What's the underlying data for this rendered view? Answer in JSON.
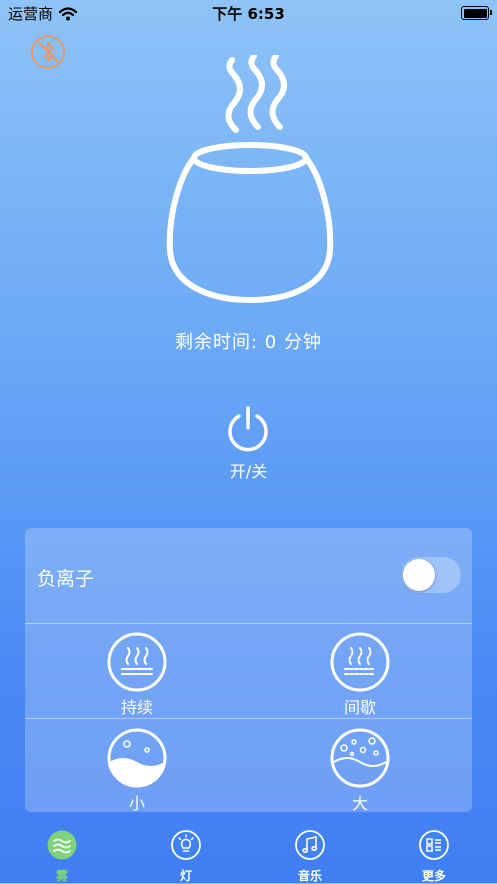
{
  "status_bar": {
    "carrier": "运营商",
    "time": "下午 6:53",
    "wifi_icon": "wifi-icon",
    "battery_icon": "battery-icon"
  },
  "header": {
    "bluetooth_icon": "bluetooth-off-icon"
  },
  "device": {
    "illustration": "diffuser-pot-icon",
    "remaining_time": "剩余时间: 0 分钟"
  },
  "power": {
    "label": "开/关",
    "icon": "power-icon"
  },
  "panel": {
    "negative_ion_label": "负离子",
    "negative_ion_on": false,
    "modes": [
      {
        "label": "持续",
        "icon": "continuous-mist-icon"
      },
      {
        "label": "间歇",
        "icon": "intermittent-mist-icon"
      },
      {
        "label": "小",
        "icon": "small-mist-icon"
      },
      {
        "label": "大",
        "icon": "large-mist-icon"
      }
    ]
  },
  "tabs": [
    {
      "label": "雾",
      "icon": "mist-icon",
      "active": true
    },
    {
      "label": "灯",
      "icon": "lightbulb-icon",
      "active": false
    },
    {
      "label": "音乐",
      "icon": "music-note-icon",
      "active": false
    },
    {
      "label": "更多",
      "icon": "more-icon",
      "active": false
    }
  ],
  "colors": {
    "active_tab": "#7fd37a",
    "background_top": "#8ec3f7",
    "background_bottom": "#3f7ff3",
    "bluetooth_icon": "#e39a6a"
  }
}
